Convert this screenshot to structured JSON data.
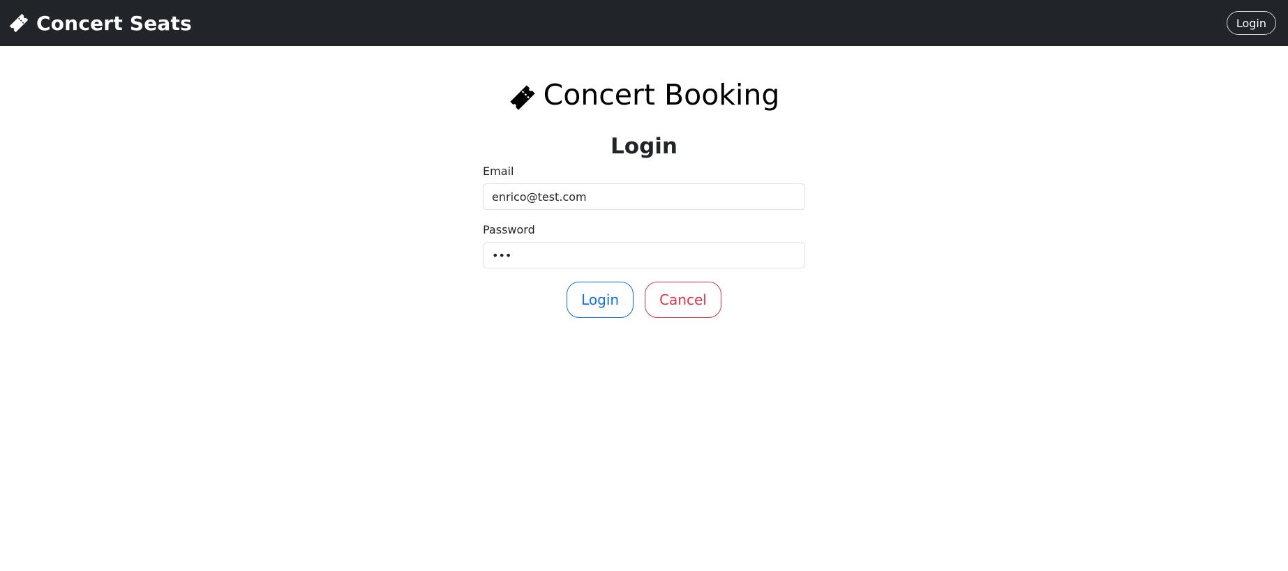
{
  "navbar": {
    "brand_icon": "ticket-icon",
    "brand_text": "Concert Seats",
    "login_label": "Login"
  },
  "main": {
    "title_icon": "ticket-icon",
    "title": "Concert Booking",
    "heading": "Login",
    "email": {
      "label": "Email",
      "value": "enrico@test.com"
    },
    "password": {
      "label": "Password",
      "value": "pwd"
    },
    "login_button": "Login",
    "cancel_button": "Cancel"
  },
  "colors": {
    "navbar_bg": "#212529",
    "primary": "#0d6efd",
    "danger": "#dc3545"
  }
}
